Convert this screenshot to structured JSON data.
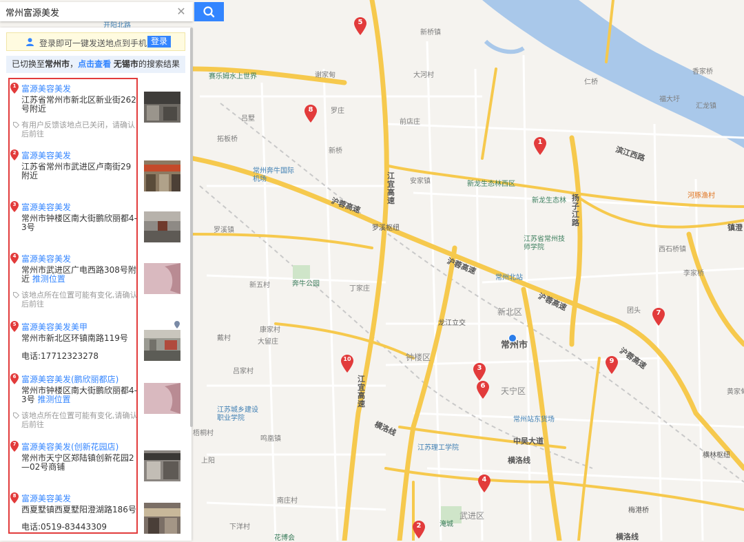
{
  "search": {
    "query": "常州富源美发",
    "clear_icon": "close-icon",
    "search_icon": "search-icon"
  },
  "login": {
    "text": "登录即可一键发送地点到手机",
    "button": "登录",
    "icon": "user-icon"
  },
  "switch_notice": {
    "prefix": "已切换至",
    "city": "常州市",
    "sep": "，",
    "link": "点击查看",
    "other_city": "无锡市",
    "suffix": "的搜索结果"
  },
  "results": [
    {
      "index": "1",
      "title": "富源美容美发",
      "address": "江苏省常州市新北区新业街262号附近",
      "note": "有用户反馈该地点已关闭，请确认后前往"
    },
    {
      "index": "2",
      "title": "富源美容美发",
      "address": "江苏省常州市武进区卢南街29附近"
    },
    {
      "index": "3",
      "title": "富源美容美发",
      "address": "常州市钟楼区南大街鹏欣丽都4-3号"
    },
    {
      "index": "4",
      "title": "富源美容美发",
      "address": "常州市武进区广电西路308号附近",
      "guess": "推测位置",
      "note": "该地点所在位置可能有变化,请确认后前往"
    },
    {
      "index": "5",
      "title": "富源美容美发美甲",
      "address": "常州市新北区环镇南路119号",
      "phone": "电话:17712323278"
    },
    {
      "index": "6",
      "title": "富源美容美发(鹏欣丽都店)",
      "address": "常州市钟楼区南大街鹏欣丽都4-3号",
      "guess": "推测位置",
      "note": "该地点所在位置可能有变化,请确认后前往"
    },
    {
      "index": "7",
      "title": "富源美容美发(创新花园店)",
      "address": "常州市天宁区郑陆镇创新花园2—02号商铺"
    },
    {
      "index": "8",
      "title": "富源美容美发",
      "address": "西夏墅镇西夏墅阳澄湖路186号",
      "phone": "电话:0519-83443309"
    }
  ],
  "map": {
    "markers": [
      "1",
      "2",
      "3",
      "4",
      "5",
      "6",
      "7",
      "8",
      "9",
      "10"
    ],
    "city_label": "常州市",
    "districts": [
      "新北区",
      "钟楼区",
      "天宁区",
      "武进区"
    ],
    "roads": [
      "沪蓉高速",
      "沪蓉高速",
      "沪蓉高速",
      "沪蓉高速",
      "江宜高速",
      "江宜高速",
      "扬子江路",
      "滨江西路",
      "横洛线",
      "横洛线",
      "横洛线",
      "中吴大道",
      "罗溪枢纽",
      "龙江立交",
      "镇澄",
      "横林枢纽",
      "梅港桥"
    ],
    "pois": [
      "赛乐姆水上世界",
      "常州奔牛国际机场",
      "新龙生态林西区",
      "新龙生态林",
      "江苏省常州技师学院",
      "常州北站",
      "奔牛公园",
      "江苏城乡建设职业学院",
      "常州站东货场",
      "江苏理工学院",
      "河豚渔村",
      "淹城",
      "花博会"
    ],
    "places": [
      "开阳北路",
      "新桥镇",
      "谢家甸",
      "大河村",
      "罗庄",
      "前店庄",
      "吕墅",
      "拓板桥",
      "新桥",
      "安家镇",
      "罗溪镇",
      "新五村",
      "丁家庄",
      "康家村",
      "大留庄",
      "戴村",
      "吕家村",
      "鸣凰镇",
      "上阳",
      "香家桥",
      "西石桥镇",
      "李家桥",
      "汇龙镇",
      "福大圩",
      "仁桥",
      "团头",
      "南庄村",
      "梧桐村",
      "下洋村",
      "黄家甸"
    ]
  },
  "colors": {
    "accent": "#3385ff",
    "marker": "#e23b3b",
    "frame": "#e23b3b",
    "road": "#f6c94d",
    "water": "#a9c8ea",
    "green": "#cfe5c9"
  }
}
